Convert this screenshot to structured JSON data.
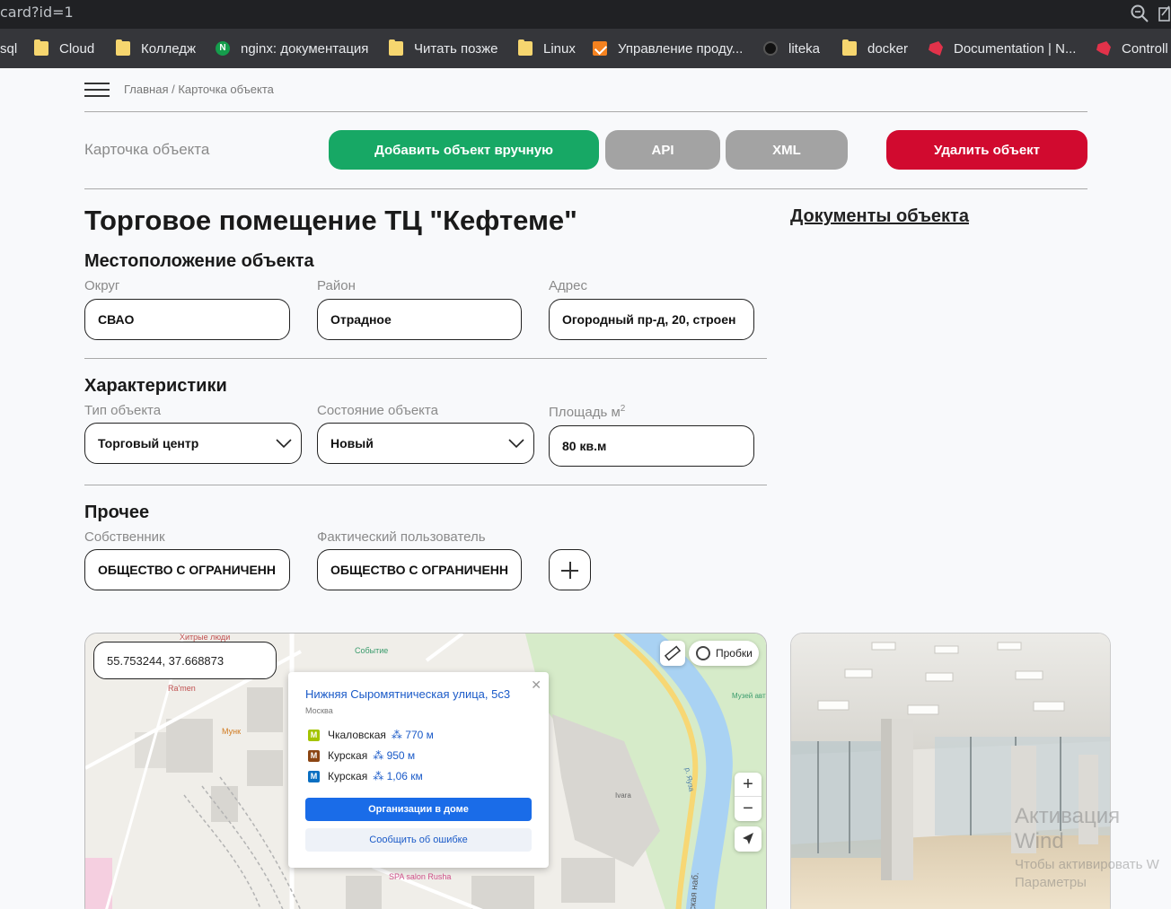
{
  "browser": {
    "url": "card?id=1",
    "bookmarks": [
      {
        "label": "sql",
        "icon": "folder-icon"
      },
      {
        "label": "Cloud",
        "icon": "folder-icon"
      },
      {
        "label": "Колледж",
        "icon": "folder-icon"
      },
      {
        "label": "nginx: документация",
        "icon": "nginx-icon"
      },
      {
        "label": "Читать позже",
        "icon": "folder-icon"
      },
      {
        "label": "Linux",
        "icon": "folder-icon"
      },
      {
        "label": "Управление проду...",
        "icon": "orange-app-icon"
      },
      {
        "label": "liteka",
        "icon": "liteka-icon"
      },
      {
        "label": "docker",
        "icon": "folder-icon"
      },
      {
        "label": "Documentation | N...",
        "icon": "nest-icon"
      },
      {
        "label": "Controll",
        "icon": "nest-icon"
      }
    ]
  },
  "breadcrumb": "Главная / Карточка объекта",
  "toolbar": {
    "card_label": "Карточка объекта",
    "add_manual": "Добавить объект вручную",
    "api": "API",
    "xml": "XML",
    "delete": "Удалить объект"
  },
  "object": {
    "title": "Торговое помещение ТЦ \"Кефтеме\"",
    "documents_link": "Документы объекта"
  },
  "location": {
    "heading": "Местоположение объекта",
    "okrug_label": "Округ",
    "okrug_value": "СВАО",
    "rayon_label": "Район",
    "rayon_value": "Отрадное",
    "address_label": "Адрес",
    "address_value": "Огородный пр-д, 20, строен"
  },
  "characteristics": {
    "heading": "Характеристики",
    "type_label": "Тип объекта",
    "type_value": "Торговый центр",
    "state_label": "Состояние объекта",
    "state_value": "Новый",
    "area_label": "Площадь м",
    "area_sup": "2",
    "area_value": "80 кв.м"
  },
  "other": {
    "heading": "Прочее",
    "owner_label": "Собственник",
    "owner_value": "ОБЩЕСТВО С ОГРАНИЧЕНН",
    "user_label": "Фактический пользователь",
    "user_value": "ОБЩЕСТВО С ОГРАНИЧЕНН"
  },
  "map": {
    "coords": "55.753244, 37.668873",
    "traffic": "Пробки",
    "popup": {
      "address": "Нижняя Сыромятническая улица, 5с3",
      "city": "Москва",
      "metro": [
        {
          "line": "М",
          "color": "#a4c400",
          "name": "Чкаловская",
          "dist": "770 м"
        },
        {
          "line": "М",
          "color": "#8b4513",
          "name": "Курская",
          "dist": "950 м"
        },
        {
          "line": "М",
          "color": "#0a6fc2",
          "name": "Курская",
          "dist": "1,06 км"
        }
      ],
      "orgs_button": "Организации в доме",
      "report_button": "Сообщить об ошибке"
    },
    "labels": [
      "Хитрые люди",
      "Событие",
      "Ra'men",
      "Мунк",
      "Ivara",
      "SPA salon Rusha",
      "Музей автомобилей мира",
      "р. Яуза",
      "ческая наб."
    ]
  },
  "watermark": {
    "line1": "Активация Wind",
    "line2": "Чтобы активировать W",
    "line3": "Параметры"
  }
}
